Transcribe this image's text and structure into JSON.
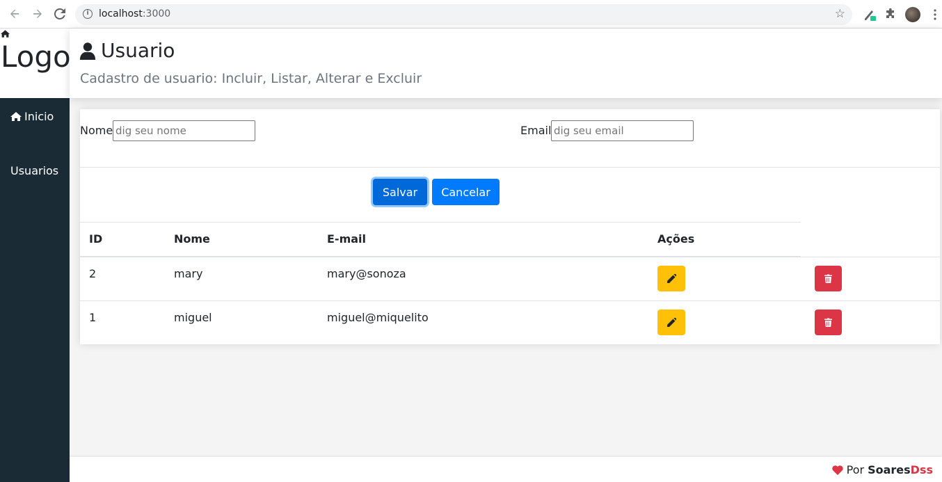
{
  "browser": {
    "url_host": "localhost",
    "url_port": ":3000"
  },
  "sidebar": {
    "logo": "Logo",
    "items": [
      {
        "label": "Inicio",
        "icon": "home-icon"
      },
      {
        "label": "Usuarios"
      }
    ]
  },
  "header": {
    "title": "Usuario",
    "subtitle": "Cadastro de usuario: Incluir, Listar, Alterar e Excluir"
  },
  "form": {
    "name_label": "Nome",
    "name_placeholder": "dig seu nome",
    "email_label": "Email",
    "email_placeholder": "dig seu email",
    "save_label": "Salvar",
    "cancel_label": "Cancelar"
  },
  "table": {
    "headers": [
      "ID",
      "Nome",
      "E-mail",
      "Ações"
    ],
    "rows": [
      {
        "id": "2",
        "name": "mary",
        "email": "mary@sonoza"
      },
      {
        "id": "1",
        "name": "miguel",
        "email": "miguel@miquelito"
      }
    ]
  },
  "footer": {
    "by": "Por",
    "author_part1": "Soares",
    "author_part2": "Dss"
  },
  "colors": {
    "sidebar": "#1a2b36",
    "primary": "#007bff",
    "warning": "#ffc107",
    "danger": "#dc3545"
  }
}
